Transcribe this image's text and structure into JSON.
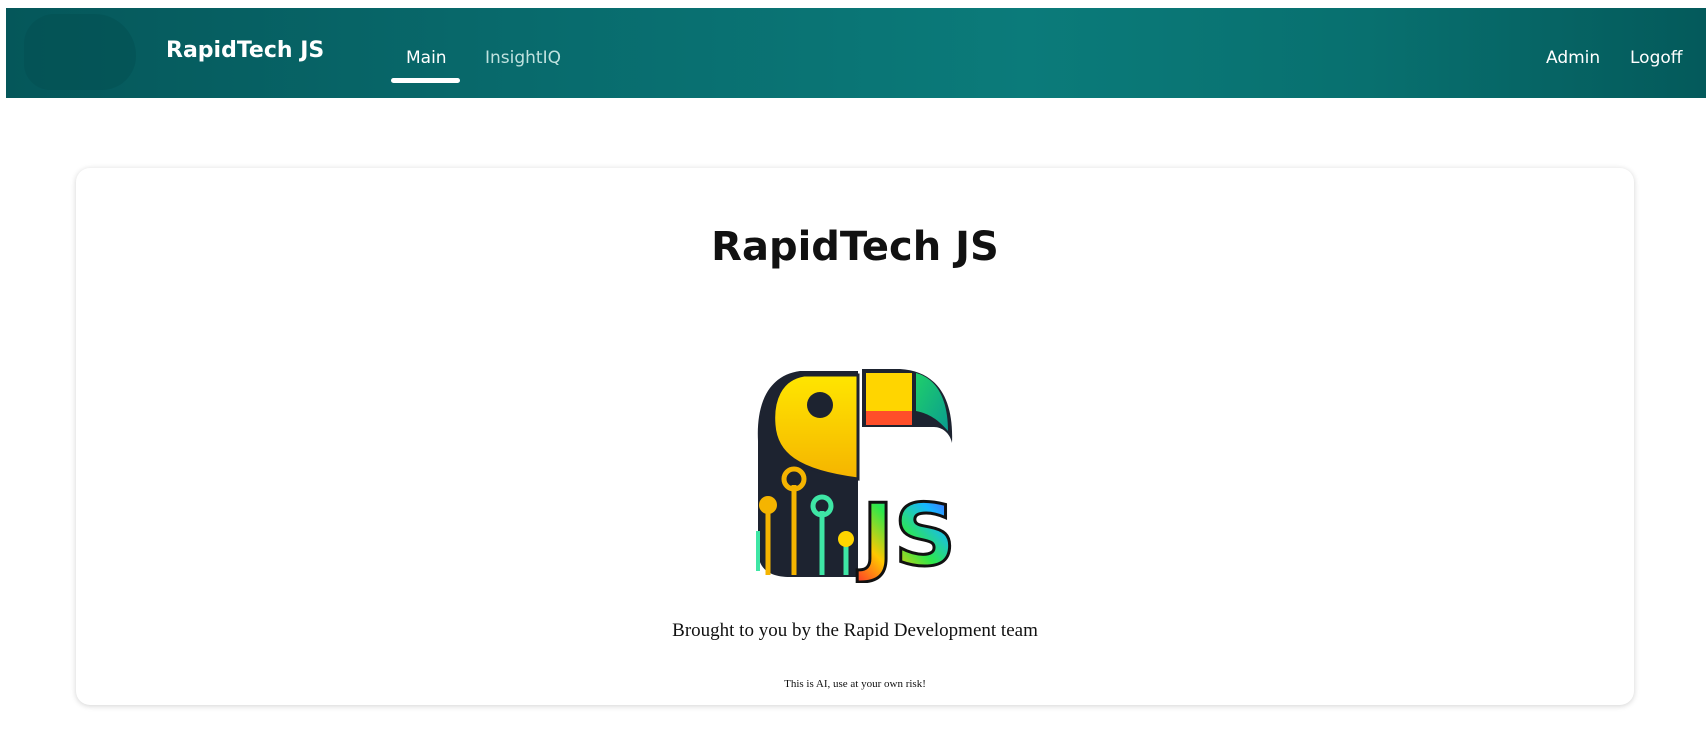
{
  "navbar": {
    "brand": "RapidTech JS",
    "links": [
      {
        "label": "Main",
        "active": true
      },
      {
        "label": "InsightIQ",
        "active": false
      }
    ],
    "right_links": [
      {
        "label": "Admin"
      },
      {
        "label": "Logoff"
      }
    ]
  },
  "main": {
    "title": "RapidTech JS",
    "logo_text": "JS",
    "tagline": "Brought to you by the Rapid Development team",
    "disclaimer": "This is AI, use at your own risk!"
  },
  "colors": {
    "nav_background": "#086a6c",
    "nav_active_text": "#ffffff",
    "nav_inactive_text": "#bfe2df",
    "card_background": "#ffffff"
  }
}
